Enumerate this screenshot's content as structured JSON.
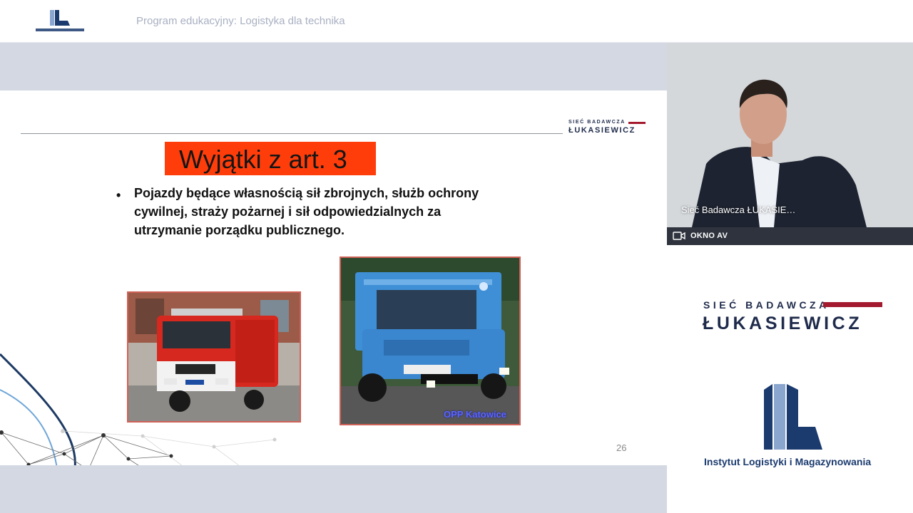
{
  "header": {
    "title": "Program edukacyjny: Logistyka dla technika",
    "logo_icon": "ilim-logo-icon"
  },
  "slide": {
    "brand_line1": "SIEĆ BADAWCZA",
    "brand_line2": "ŁUKASIEWICZ",
    "title": "Wyjątki z art. 3",
    "title_bg": "#ff3d0a",
    "bullet_symbol": "•",
    "bullet_text": "Pojazdy będące własnością sił zbrojnych, służb ochrony cywilnej, straży pożarnej i sił odpowiedzialnych za utrzymanie porządku publicznego.",
    "photo1_icon": "fire-truck-photo",
    "photo2_icon": "police-truck-photo",
    "photo2_caption": "OPP Katowice",
    "page_number": "26"
  },
  "video": {
    "participant_name": "Sieć Badawcza ŁUKASIE…",
    "av_icon": "camera-icon",
    "av_label": "OKNO AV"
  },
  "side_branding": {
    "line1": "SIEĆ BADAWCZA",
    "line2": "ŁUKASIEWICZ",
    "institute_name": "Instytut Logistyki i Magazynowania",
    "accent_color": "#a3192e",
    "navy_color": "#1f2b4b"
  }
}
